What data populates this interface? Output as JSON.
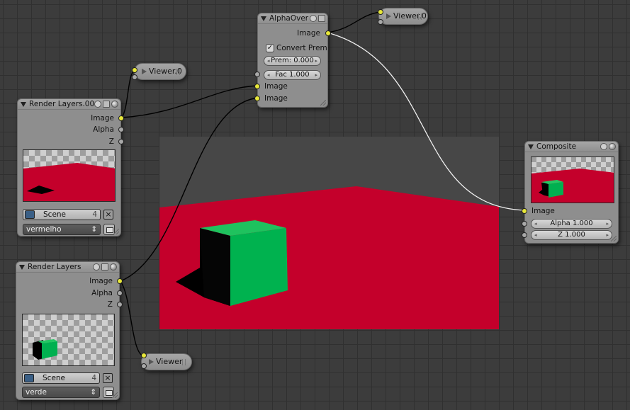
{
  "nodes": {
    "alpha_over": {
      "title": "AlphaOver",
      "output_label": "Image",
      "convert_prem_label": "Convert Prem",
      "convert_prem_checked": true,
      "prem_label": "Prem: 0.000",
      "fac_label": "Fac 1.000",
      "input1_label": "Image",
      "input2_label": "Image"
    },
    "render_layers_00": {
      "title": "Render Layers.00",
      "outputs": [
        "Image",
        "Alpha",
        "Z"
      ],
      "scene_label": "Scene",
      "scene_count": "4",
      "layer_select": "vermelho"
    },
    "render_layers": {
      "title": "Render Layers",
      "outputs": [
        "Image",
        "Alpha",
        "Z"
      ],
      "scene_label": "Scene",
      "scene_count": "4",
      "layer_select": "verde"
    },
    "composite": {
      "title": "Composite",
      "input_label": "Image",
      "alpha_label": "Alpha 1.000",
      "z_label": "Z 1.000"
    },
    "viewer_top": {
      "title": "Viewer.0"
    },
    "viewer_mid": {
      "title": "Viewer.0"
    },
    "viewer_bottom": {
      "title": "Viewer"
    }
  },
  "icons": {
    "x": "×",
    "check": "✓",
    "updown": "⇕",
    "arrow_l": "◂",
    "arrow_r": "▸"
  },
  "colors": {
    "floor_red": "#c4002b",
    "cube_green": "#00b050",
    "socket_yellow": "#e8e83a",
    "grid_bg": "#3c3c3c",
    "backdrop_gray": "#474747"
  }
}
